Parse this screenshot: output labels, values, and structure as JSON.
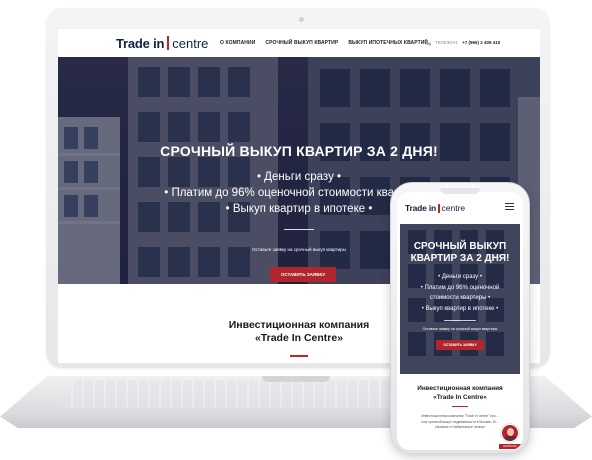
{
  "laptop_site": {
    "logo": {
      "brand": "Trade in",
      "suffix": "centre"
    },
    "nav": [
      {
        "label": "О КОМПАНИИ"
      },
      {
        "label": "СРОЧНЫЙ ВЫКУП КВАРТИР"
      },
      {
        "label": "ВЫКУП ИПОТЕЧНЫХ КВАРТИР"
      }
    ],
    "phone": {
      "label": "ТЕЛЕФОН:",
      "number": "+7 (966) 2 409 410"
    },
    "hero": {
      "title": "СРОЧНЫЙ ВЫКУП КВАРТИР ЗА 2 ДНЯ!",
      "lines": [
        "• Деньги сразу •",
        "• Платим до 96% оценочной стоимости квартиры •",
        "• Выкуп квартир в ипотеке •"
      ],
      "note": "Оставьте заявку на срочный выкуп квартиры",
      "button": "ОСТАВИТЬ ЗАЯВКУ"
    },
    "about": {
      "line1": "Инвестиционная компания",
      "line2": "«Trade In Centre»"
    }
  },
  "mobile_site": {
    "logo": {
      "brand": "Trade in",
      "suffix": "centre"
    },
    "hero": {
      "title_line1": "СРОЧНЫЙ ВЫКУП",
      "title_line2": "КВАРТИР ЗА 2 ДНЯ!",
      "lines": [
        "• Деньги сразу •",
        "• Платим до 96% оценочной",
        "стоимости квартиры •",
        "• Выкуп квартир в ипотеке •"
      ],
      "note": "Оставьте заявку на срочный выкуп квартиры",
      "button": "ОСТАВИТЬ ЗАЯВКУ"
    },
    "about": {
      "line1": "Инвестиционная компания",
      "line2": "«Trade In Centre»",
      "desc_line1": "Инвестиционная компания \"Trade in centre\" про...",
      "desc_line2": "ком срочный выкуп недвижимости в Москве, М...",
      "desc_line3": "Ижевске и Набережных Челнах"
    },
    "chat_button": "НАПИСАТЬ"
  },
  "colors": {
    "brand_navy": "#13213f",
    "accent_red": "#b1262d",
    "hero_overlay": "#1c1e3a"
  }
}
